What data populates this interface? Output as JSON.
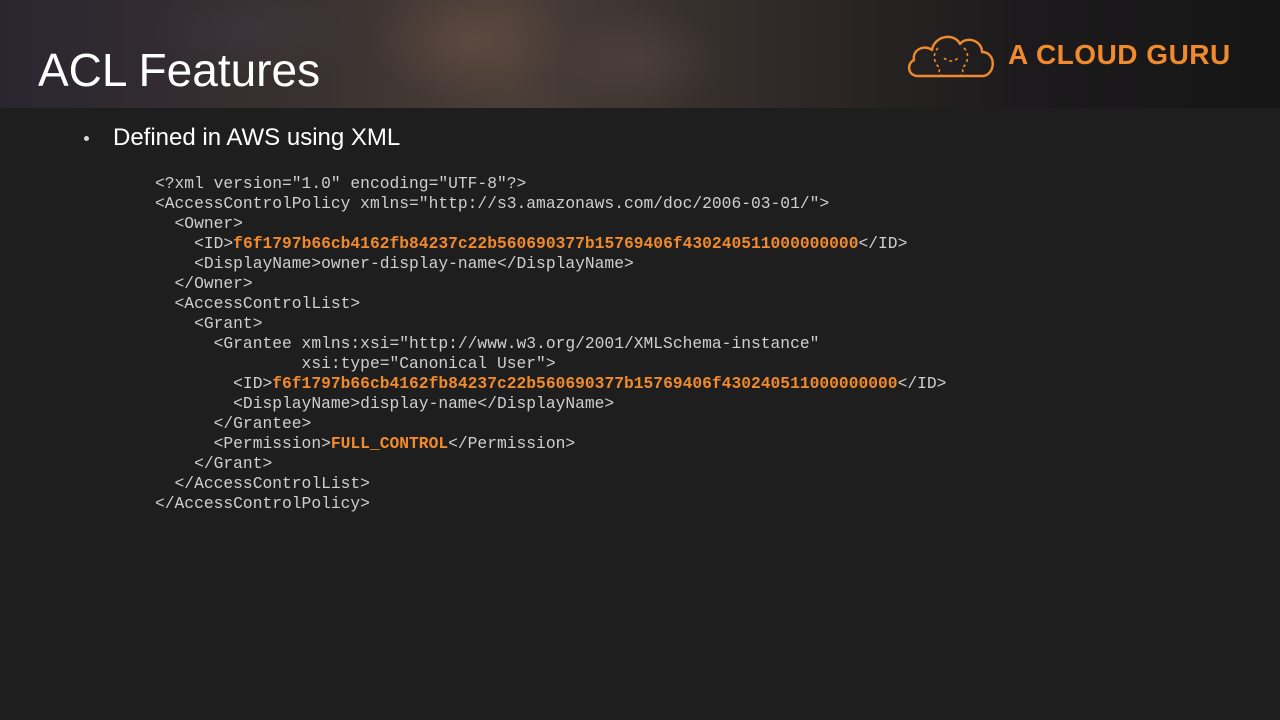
{
  "slide": {
    "title": "ACL Features",
    "logo_text": "A CLOUD GURU",
    "logo_icon": "cloud-with-guru-figure-icon",
    "colors": {
      "background": "#1e1e1e",
      "accent": "#f08a2c",
      "text": "#ffffff",
      "code_text": "#cfcfcf"
    }
  },
  "bullets": [
    {
      "text": "Defined in AWS using XML"
    }
  ],
  "code": {
    "language": "xml",
    "lines": [
      {
        "pre": "<?xml version=\"1.0\" encoding=\"UTF-8\"?>",
        "hl": "",
        "post": ""
      },
      {
        "pre": "<AccessControlPolicy xmlns=\"http://s3.amazonaws.com/doc/2006-03-01/\">",
        "hl": "",
        "post": ""
      },
      {
        "pre": "  <Owner>",
        "hl": "",
        "post": ""
      },
      {
        "pre": "    <ID>",
        "hl": "f6f1797b66cb4162fb84237c22b560690377b15769406f430240511000000000",
        "post": "</ID>"
      },
      {
        "pre": "    <DisplayName>owner-display-name</DisplayName>",
        "hl": "",
        "post": ""
      },
      {
        "pre": "  </Owner>",
        "hl": "",
        "post": ""
      },
      {
        "pre": "  <AccessControlList>",
        "hl": "",
        "post": ""
      },
      {
        "pre": "    <Grant>",
        "hl": "",
        "post": ""
      },
      {
        "pre": "      <Grantee xmlns:xsi=\"http://www.w3.org/2001/XMLSchema-instance\"",
        "hl": "",
        "post": ""
      },
      {
        "pre": "               xsi:type=\"Canonical User\">",
        "hl": "",
        "post": ""
      },
      {
        "pre": "        <ID>",
        "hl": "f6f1797b66cb4162fb84237c22b560690377b15769406f430240511000000000",
        "post": "</ID>"
      },
      {
        "pre": "        <DisplayName>display-name</DisplayName>",
        "hl": "",
        "post": ""
      },
      {
        "pre": "      </Grantee>",
        "hl": "",
        "post": ""
      },
      {
        "pre": "      <Permission>",
        "hl": "FULL_CONTROL",
        "post": "</Permission>"
      },
      {
        "pre": "    </Grant>",
        "hl": "",
        "post": ""
      },
      {
        "pre": "  </AccessControlList>",
        "hl": "",
        "post": ""
      },
      {
        "pre": "</AccessControlPolicy>",
        "hl": "",
        "post": ""
      }
    ]
  }
}
